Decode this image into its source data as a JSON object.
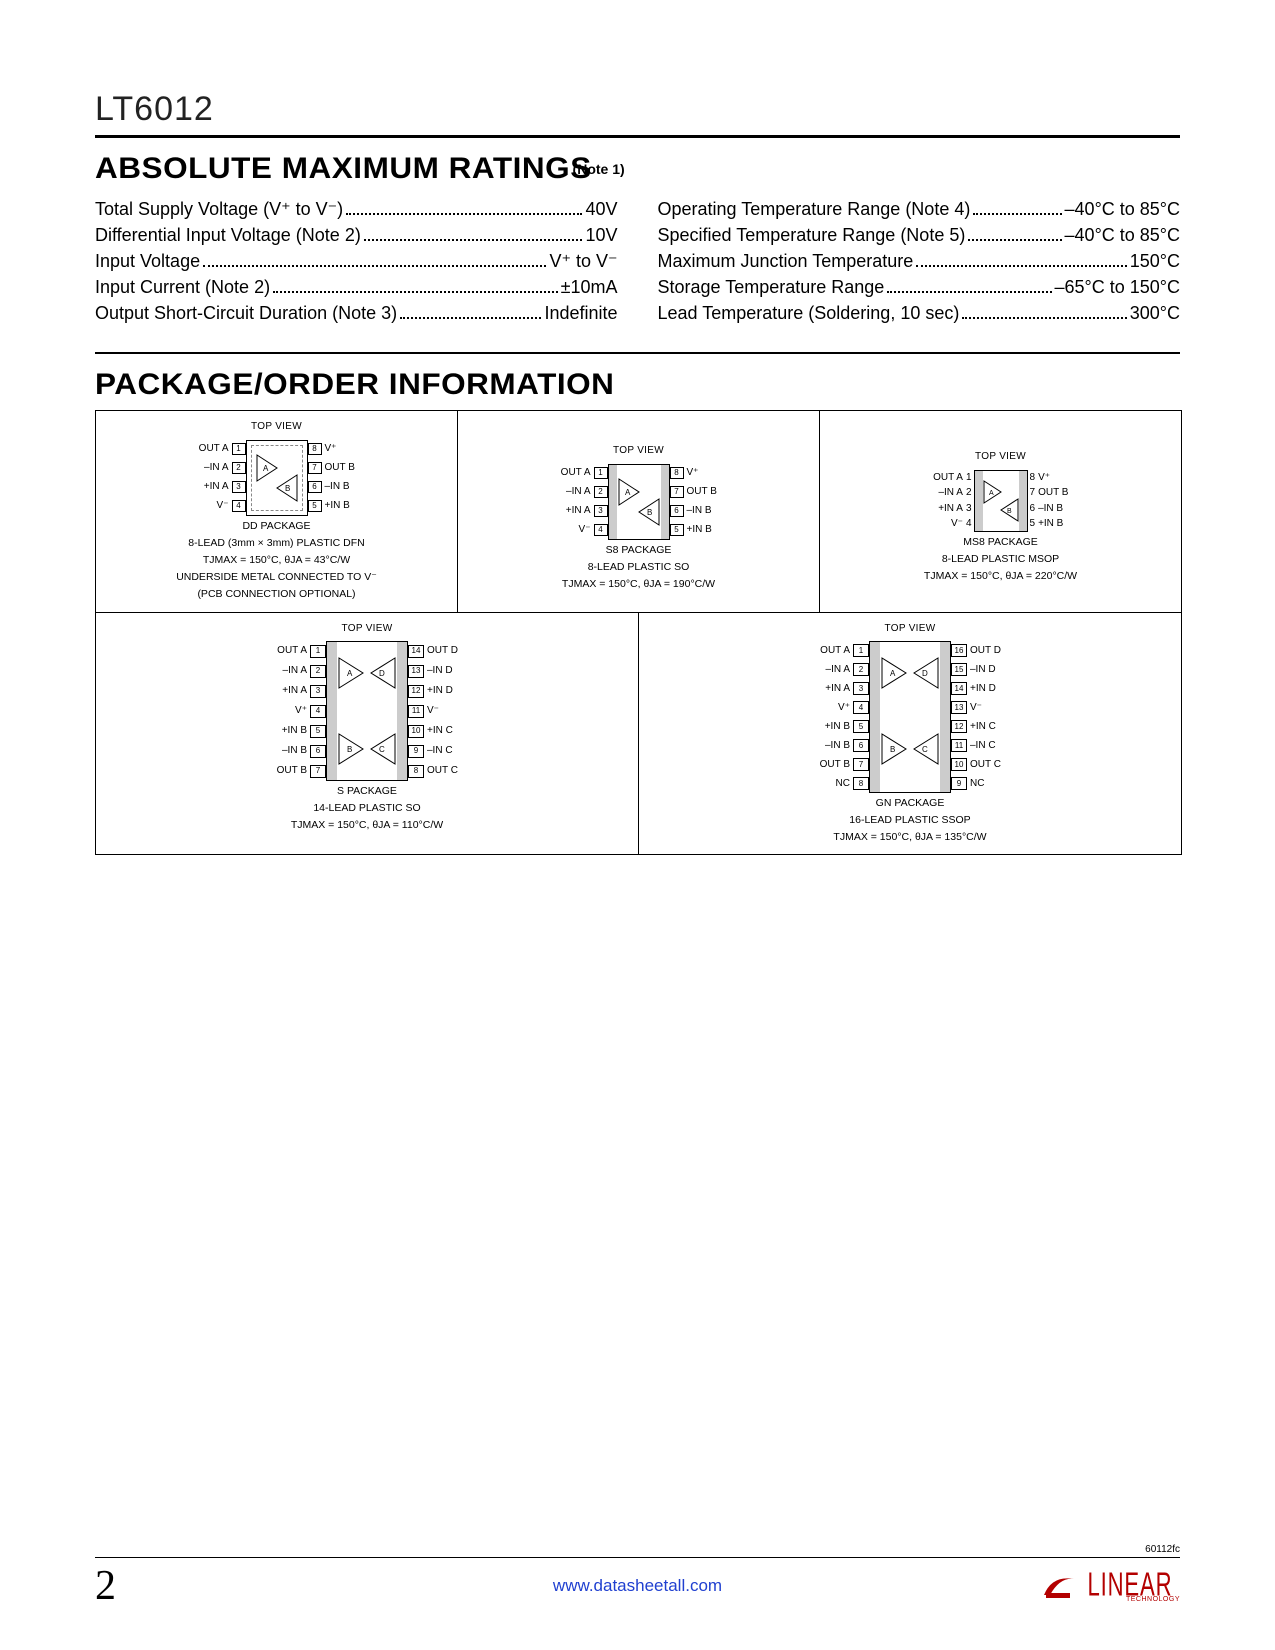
{
  "part_number": "LT6012",
  "sections": {
    "ratings_title": "ABSOLUTE MAXIMUM RATINGS",
    "ratings_note": "(Note 1)",
    "package_title": "PACKAGE/ORDER INFORMATION"
  },
  "ratings": {
    "left": [
      {
        "label": "Total Supply Voltage (V⁺ to V⁻)",
        "value": "40V"
      },
      {
        "label": "Differential Input Voltage (Note 2)",
        "value": "10V"
      },
      {
        "label": "Input Voltage",
        "value": "V⁺ to V⁻"
      },
      {
        "label": "Input Current (Note 2)",
        "value": "±10mA"
      },
      {
        "label": "Output Short-Circuit Duration (Note 3)",
        "value": "Indefinite"
      }
    ],
    "right": [
      {
        "label": "Operating Temperature Range (Note 4)",
        "value": "–40°C to 85°C"
      },
      {
        "label": "Specified Temperature Range (Note 5)",
        "value": "–40°C to 85°C"
      },
      {
        "label": "Maximum Junction Temperature",
        "value": "150°C"
      },
      {
        "label": "Storage Temperature Range",
        "value": "–65°C to 150°C"
      },
      {
        "label": "Lead Temperature (Soldering, 10 sec)",
        "value": "300°C"
      }
    ]
  },
  "packages": {
    "top_view": "TOP VIEW",
    "pin8_left": [
      "OUT A",
      "–IN A",
      "+IN A",
      "V⁻"
    ],
    "pin8_right": [
      "V⁺",
      "OUT B",
      "–IN B",
      "+IN B"
    ],
    "pin8_nums_left": [
      "1",
      "2",
      "3",
      "4"
    ],
    "pin8_nums_right": [
      "8",
      "7",
      "6",
      "5"
    ],
    "dd": {
      "name": "DD PACKAGE",
      "desc": "8-LEAD (3mm × 3mm) PLASTIC DFN",
      "therm": "TJMAX = 150°C, θJA = 43°C/W",
      "note1": "UNDERSIDE METAL CONNECTED TO V⁻",
      "note2": "(PCB CONNECTION OPTIONAL)"
    },
    "s8": {
      "name": "S8 PACKAGE",
      "desc": "8-LEAD PLASTIC SO",
      "therm": "TJMAX = 150°C, θJA = 190°C/W"
    },
    "ms8": {
      "name": "MS8 PACKAGE",
      "desc": "8-LEAD PLASTIC MSOP",
      "therm": "TJMAX = 150°C, θJA = 220°C/W"
    },
    "pin14_left": [
      "OUT A",
      "–IN A",
      "+IN A",
      "V⁺",
      "+IN B",
      "–IN B",
      "OUT B"
    ],
    "pin14_right": [
      "OUT D",
      "–IN D",
      "+IN D",
      "V⁻",
      "+IN C",
      "–IN C",
      "OUT C"
    ],
    "pin14_nums_left": [
      "1",
      "2",
      "3",
      "4",
      "5",
      "6",
      "7"
    ],
    "pin14_nums_right": [
      "14",
      "13",
      "12",
      "11",
      "10",
      "9",
      "8"
    ],
    "s": {
      "name": "S PACKAGE",
      "desc": "14-LEAD PLASTIC SO",
      "therm": "TJMAX = 150°C, θJA = 110°C/W"
    },
    "pin16_left": [
      "OUT A",
      "–IN A",
      "+IN A",
      "V⁺",
      "+IN B",
      "–IN B",
      "OUT B",
      "NC"
    ],
    "pin16_right": [
      "OUT D",
      "–IN D",
      "+IN D",
      "V⁻",
      "+IN C",
      "–IN C",
      "OUT C",
      "NC"
    ],
    "pin16_nums_left": [
      "1",
      "2",
      "3",
      "4",
      "5",
      "6",
      "7",
      "8"
    ],
    "pin16_nums_right": [
      "16",
      "15",
      "14",
      "13",
      "12",
      "11",
      "10",
      "9"
    ],
    "gn": {
      "name": "GN PACKAGE",
      "desc": "16-LEAD PLASTIC SSOP",
      "therm": "TJMAX = 150°C, θJA = 135°C/W"
    }
  },
  "footer": {
    "code": "60112fc",
    "page": "2",
    "url": "www.datasheetall.com",
    "logo_text": "LINEAR",
    "logo_sub": "TECHNOLOGY"
  },
  "amp_labels": {
    "A": "A",
    "B": "B",
    "C": "C",
    "D": "D"
  }
}
